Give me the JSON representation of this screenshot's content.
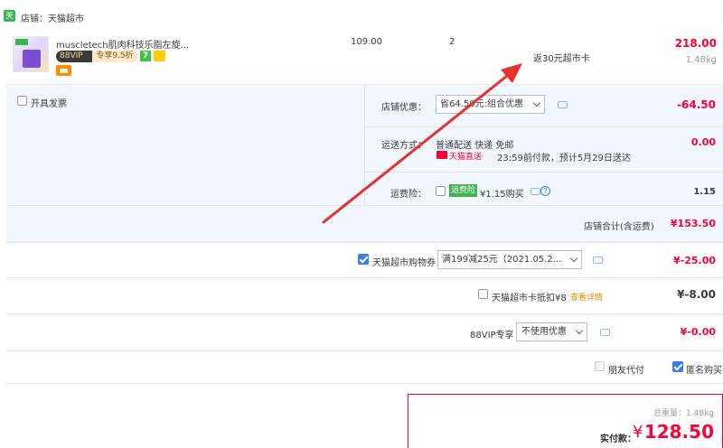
{
  "store": {
    "icon_text": "天猫",
    "label": "店铺：天猫超市"
  },
  "item": {
    "title": "muscletech肌肉科技乐脂左旋...",
    "vip_badge": "88VIP",
    "vip_discount": "专享9.5折",
    "badge_7": "7",
    "unit_price": "109.00",
    "quantity": "2",
    "rebate": "返30元超市卡",
    "subtotal": "218.00",
    "weight": "1.48kg"
  },
  "options": {
    "invoice_label": "开具发票",
    "store_discount_label": "店铺优惠：",
    "store_discount_value": "省64.50元:组合优惠",
    "store_discount_amount": "-64.50",
    "shipping_label": "运送方式：",
    "shipping_method": "普通配送 快递 免邮",
    "tmall_direct_label": "天猫直送",
    "delivery_note": "23:59前付款，预计5月29日送达",
    "shipping_amount": "0.00",
    "insurance_label": "运费险：",
    "insurance_badge": "运费险",
    "insurance_price": "¥1.15购买",
    "insurance_help": "?",
    "insurance_amount": "1.15",
    "store_total_label": "店铺合计(含运费)",
    "store_total_amount": "¥153.50"
  },
  "coupon": {
    "label": "天猫超市购物券",
    "value": "满199减25元（2021.05.2...",
    "amount": "¥-25.00"
  },
  "card": {
    "label": "天猫超市卡抵扣¥8",
    "details_link": "查看详情",
    "amount": "¥-8.00"
  },
  "vip": {
    "label": "88VIP专享",
    "value": "不使用优惠",
    "amount": "¥-0.00"
  },
  "flags": {
    "friend_pay_label": "朋友代付",
    "anonymous_label": "匿名购买"
  },
  "total": {
    "weight": "总重量：1.48kg",
    "actual_pay_label": "实付款：",
    "currency": "¥",
    "amount": "128.50"
  },
  "colors": {
    "accent_red": "#ff0036",
    "annotation_red": "#e8302c",
    "link_blue": "#3a7ee4",
    "panel_bg": "#f1f6ff"
  }
}
